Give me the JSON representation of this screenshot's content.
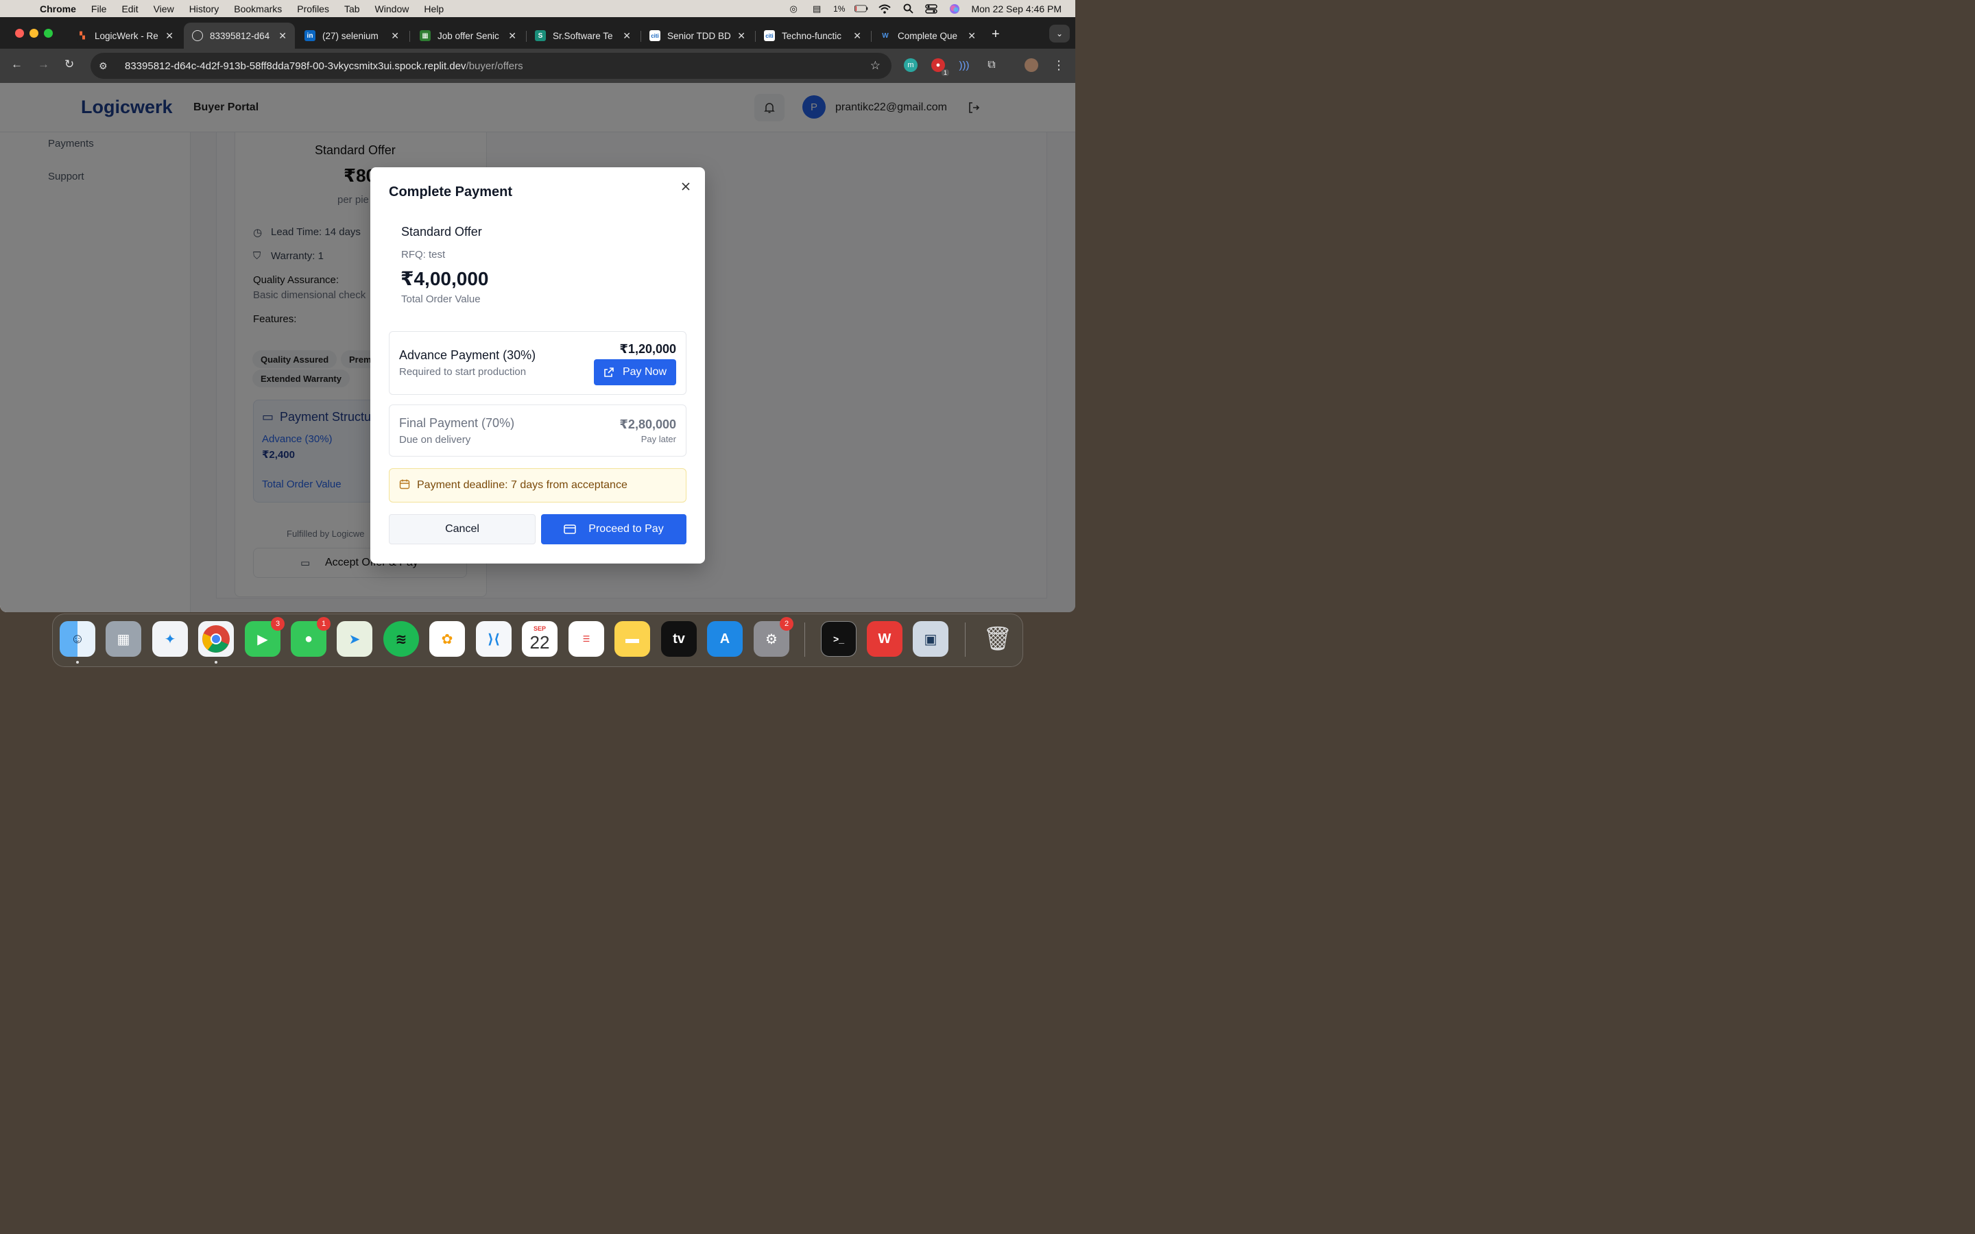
{
  "menubar": {
    "app": "Chrome",
    "items": [
      "File",
      "Edit",
      "View",
      "History",
      "Bookmarks",
      "Profiles",
      "Tab",
      "Window",
      "Help"
    ],
    "battery": "1%",
    "datetime": "Mon 22 Sep  4:46 PM"
  },
  "tabs": [
    {
      "label": "LogicWerk - Re",
      "active": false
    },
    {
      "label": "83395812-d64",
      "active": true
    },
    {
      "label": "(27) selenium",
      "active": false
    },
    {
      "label": "Job offer Senic",
      "active": false
    },
    {
      "label": "Sr.Software Te",
      "active": false
    },
    {
      "label": "Senior TDD BD",
      "active": false
    },
    {
      "label": "Techno-functic",
      "active": false
    },
    {
      "label": "Complete Que",
      "active": false
    }
  ],
  "toolbar": {
    "url_host": "83395812-d64c-4d2f-913b-58ff8dda798f-00-3vkycsmitx3ui.spock.replit.dev",
    "url_path": "/buyer/offers",
    "ext_badge": "1"
  },
  "header": {
    "brand": "Logicwerk",
    "portal": "Buyer Portal",
    "avatar_initial": "P",
    "email": "prantikc22@gmail.com"
  },
  "sidebar": {
    "items": [
      "Payments",
      "Support"
    ]
  },
  "offer_card": {
    "title": "Standard Offer",
    "price": "₹80",
    "price_unit": "per pie",
    "lead_time": "Lead Time: 14 days",
    "warranty": "Warranty: 1",
    "qa_label": "Quality Assurance:",
    "qa_value": "Basic dimensional check",
    "features_label": "Features:",
    "features": [
      "Quality Assured",
      "Prem",
      "Extended Warranty"
    ],
    "payment_structure": "Payment Structu",
    "advance_label": "Advance (30%)",
    "advance_value": "₹2,400",
    "total_order_value": "Total Order Value",
    "fulfilled_by": "Fulfilled by Logicwe",
    "accept_label": "Accept Offer & Pay"
  },
  "modal": {
    "title": "Complete Payment",
    "offer_name": "Standard Offer",
    "rfq": "RFQ: test",
    "total_amount": "₹4,00,000",
    "total_label": "Total Order Value",
    "advance": {
      "title": "Advance Payment (30%)",
      "subtitle": "Required to start production",
      "amount": "₹1,20,000",
      "button": "Pay Now"
    },
    "final": {
      "title": "Final Payment (70%)",
      "subtitle": "Due on delivery",
      "amount": "₹2,80,000",
      "note": "Pay later"
    },
    "deadline": "Payment deadline: 7 days from acceptance",
    "cancel": "Cancel",
    "proceed": "Proceed to Pay"
  },
  "dock": {
    "facetime_badge": "3",
    "messages_badge": "1",
    "calendar_month": "SEP",
    "calendar_day": "22",
    "settings_badge": "2"
  },
  "colors": {
    "primary": "#2563eb",
    "brand": "#1d3f8f",
    "warning_bg": "#fffbea",
    "warning_text": "#7a4a0a"
  }
}
